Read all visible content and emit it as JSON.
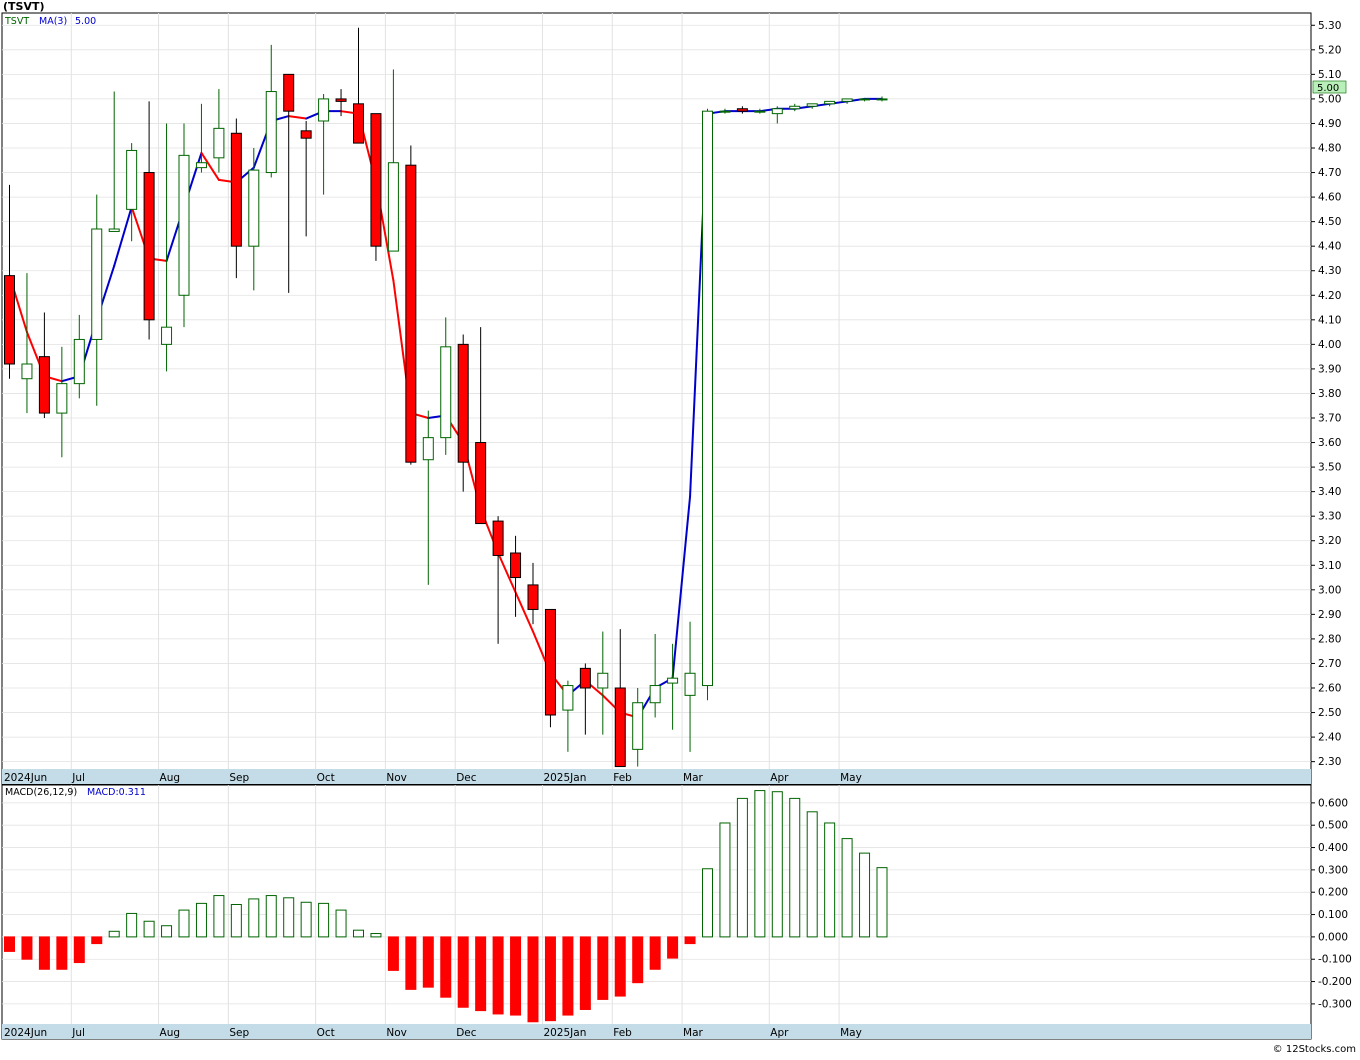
{
  "header": {
    "ticker_label": "(TSVT)"
  },
  "price_panel": {
    "legend_symbol": "TSVT",
    "legend_ma_label": "MA(3)",
    "legend_ma_value": "5.00",
    "last_price_badge": "5.00"
  },
  "macd_panel": {
    "legend_label": "MACD(26,12,9)",
    "legend_value": "MACD:0.311"
  },
  "footer": {
    "watermark": "© 12Stocks.com"
  },
  "colors": {
    "up": "#006400",
    "down": "#ff0000",
    "ma_up": "#0000cc",
    "ma_down": "#ff0000",
    "axis_band": "#c4dce8",
    "grid": "#e2e2e2",
    "badge_bg": "#b9f0b9"
  },
  "chart_data": [
    {
      "type": "candlestick",
      "period": "weekly",
      "y_axis": {
        "range": [
          2.27,
          5.35
        ],
        "ticks": [
          "2.30",
          "2.40",
          "2.50",
          "2.60",
          "2.70",
          "2.80",
          "2.90",
          "3.00",
          "3.10",
          "3.20",
          "3.30",
          "3.40",
          "3.50",
          "3.60",
          "3.70",
          "3.80",
          "3.90",
          "4.00",
          "4.10",
          "4.20",
          "4.30",
          "4.40",
          "4.50",
          "4.60",
          "4.70",
          "4.80",
          "4.90",
          "5.00",
          "5.10",
          "5.20",
          "5.30"
        ]
      },
      "x_axis": {
        "labels": [
          {
            "label": "2024Jun",
            "week": 0
          },
          {
            "label": "Jul",
            "week": 4
          },
          {
            "label": "Aug",
            "week": 9
          },
          {
            "label": "Sep",
            "week": 13
          },
          {
            "label": "Oct",
            "week": 18
          },
          {
            "label": "Nov",
            "week": 22
          },
          {
            "label": "Dec",
            "week": 26
          },
          {
            "label": "2025Jan",
            "week": 31
          },
          {
            "label": "Feb",
            "week": 35
          },
          {
            "label": "Mar",
            "week": 39
          },
          {
            "label": "Apr",
            "week": 44
          },
          {
            "label": "May",
            "week": 48
          }
        ]
      },
      "candles": [
        {
          "o": 4.28,
          "h": 4.65,
          "l": 3.86,
          "c": 3.92
        },
        {
          "o": 3.86,
          "h": 4.29,
          "l": 3.72,
          "c": 3.92
        },
        {
          "o": 3.95,
          "h": 4.13,
          "l": 3.7,
          "c": 3.72
        },
        {
          "o": 3.72,
          "h": 3.99,
          "l": 3.54,
          "c": 3.84
        },
        {
          "o": 3.84,
          "h": 4.12,
          "l": 3.78,
          "c": 4.02
        },
        {
          "o": 4.02,
          "h": 4.61,
          "l": 3.75,
          "c": 4.47
        },
        {
          "o": 4.46,
          "h": 5.03,
          "l": 4.46,
          "c": 4.47
        },
        {
          "o": 4.55,
          "h": 4.82,
          "l": 4.42,
          "c": 4.79
        },
        {
          "o": 4.7,
          "h": 4.99,
          "l": 4.02,
          "c": 4.1
        },
        {
          "o": 4.0,
          "h": 4.9,
          "l": 3.89,
          "c": 4.07
        },
        {
          "o": 4.2,
          "h": 4.9,
          "l": 4.07,
          "c": 4.77
        },
        {
          "o": 4.72,
          "h": 4.98,
          "l": 4.7,
          "c": 4.74
        },
        {
          "o": 4.76,
          "h": 5.04,
          "l": 4.7,
          "c": 4.88
        },
        {
          "o": 4.86,
          "h": 4.92,
          "l": 4.27,
          "c": 4.4
        },
        {
          "o": 4.4,
          "h": 4.8,
          "l": 4.22,
          "c": 4.71
        },
        {
          "o": 4.7,
          "h": 5.22,
          "l": 4.68,
          "c": 5.03
        },
        {
          "o": 5.1,
          "h": 5.1,
          "l": 4.21,
          "c": 4.95
        },
        {
          "o": 4.87,
          "h": 4.91,
          "l": 4.44,
          "c": 4.84
        },
        {
          "o": 4.91,
          "h": 5.02,
          "l": 4.61,
          "c": 5.0
        },
        {
          "o": 5.0,
          "h": 5.04,
          "l": 4.93,
          "c": 4.99
        },
        {
          "o": 4.98,
          "h": 5.29,
          "l": 4.87,
          "c": 4.82
        },
        {
          "o": 4.94,
          "h": 4.94,
          "l": 4.34,
          "c": 4.4
        },
        {
          "o": 4.38,
          "h": 5.12,
          "l": 4.38,
          "c": 4.74
        },
        {
          "o": 4.73,
          "h": 4.81,
          "l": 3.51,
          "c": 3.52
        },
        {
          "o": 3.53,
          "h": 3.73,
          "l": 3.02,
          "c": 3.62
        },
        {
          "o": 3.62,
          "h": 4.11,
          "l": 3.55,
          "c": 3.99
        },
        {
          "o": 4.0,
          "h": 4.04,
          "l": 3.4,
          "c": 3.52
        },
        {
          "o": 3.6,
          "h": 4.07,
          "l": 3.27,
          "c": 3.27
        },
        {
          "o": 3.28,
          "h": 3.3,
          "l": 2.78,
          "c": 3.14
        },
        {
          "o": 3.15,
          "h": 3.22,
          "l": 2.89,
          "c": 3.05
        },
        {
          "o": 3.02,
          "h": 3.11,
          "l": 2.86,
          "c": 2.92
        },
        {
          "o": 2.92,
          "h": 2.92,
          "l": 2.44,
          "c": 2.49
        },
        {
          "o": 2.51,
          "h": 2.63,
          "l": 2.34,
          "c": 2.61
        },
        {
          "o": 2.68,
          "h": 2.7,
          "l": 2.41,
          "c": 2.6
        },
        {
          "o": 2.6,
          "h": 2.83,
          "l": 2.41,
          "c": 2.66
        },
        {
          "o": 2.6,
          "h": 2.84,
          "l": 2.28,
          "c": 2.28
        },
        {
          "o": 2.35,
          "h": 2.6,
          "l": 2.28,
          "c": 2.54
        },
        {
          "o": 2.54,
          "h": 2.82,
          "l": 2.48,
          "c": 2.61
        },
        {
          "o": 2.62,
          "h": 2.78,
          "l": 2.43,
          "c": 2.64
        },
        {
          "o": 2.57,
          "h": 2.87,
          "l": 2.34,
          "c": 2.66
        },
        {
          "o": 2.61,
          "h": 4.96,
          "l": 2.55,
          "c": 4.95
        },
        {
          "o": 4.95,
          "h": 4.96,
          "l": 4.94,
          "c": 4.95
        },
        {
          "o": 4.96,
          "h": 4.97,
          "l": 4.94,
          "c": 4.95
        },
        {
          "o": 4.95,
          "h": 4.96,
          "l": 4.94,
          "c": 4.95
        },
        {
          "o": 4.94,
          "h": 4.97,
          "l": 4.9,
          "c": 4.96
        },
        {
          "o": 4.96,
          "h": 4.98,
          "l": 4.95,
          "c": 4.97
        },
        {
          "o": 4.97,
          "h": 4.98,
          "l": 4.96,
          "c": 4.98
        },
        {
          "o": 4.98,
          "h": 4.99,
          "l": 4.97,
          "c": 4.99
        },
        {
          "o": 4.99,
          "h": 5.0,
          "l": 4.98,
          "c": 5.0
        },
        {
          "o": 5.0,
          "h": 5.0,
          "l": 4.99,
          "c": 5.0
        },
        {
          "o": 5.0,
          "h": 5.01,
          "l": 4.99,
          "c": 5.0
        }
      ],
      "ma3": [
        4.28,
        4.05,
        3.87,
        3.85,
        3.87,
        4.1,
        4.32,
        4.56,
        4.35,
        4.34,
        4.56,
        4.78,
        4.67,
        4.66,
        4.72,
        4.91,
        4.93,
        4.92,
        4.95,
        4.95,
        4.94,
        4.66,
        4.26,
        3.72,
        3.7,
        3.71,
        3.6,
        3.33,
        3.15,
        2.99,
        2.83,
        2.66,
        2.57,
        2.63,
        2.57,
        2.5,
        2.48,
        2.6,
        2.64,
        3.38,
        4.94,
        4.95,
        4.95,
        4.95,
        4.96,
        4.96,
        4.97,
        4.98,
        4.99,
        5.0,
        5.0
      ]
    },
    {
      "type": "bar",
      "name": "MACD(26,12,9)",
      "y_axis": {
        "range": [
          -0.39,
          0.68
        ],
        "ticks": [
          "-0.300",
          "-0.200",
          "-0.100",
          "0.000",
          "0.100",
          "0.200",
          "0.300",
          "0.400",
          "0.500",
          "0.600"
        ]
      },
      "values": [
        -0.065,
        -0.1,
        -0.145,
        -0.145,
        -0.115,
        -0.03,
        0.025,
        0.105,
        0.07,
        0.05,
        0.12,
        0.15,
        0.185,
        0.145,
        0.17,
        0.185,
        0.175,
        0.155,
        0.15,
        0.12,
        0.03,
        0.015,
        -0.15,
        -0.235,
        -0.225,
        -0.27,
        -0.315,
        -0.33,
        -0.345,
        -0.35,
        -0.38,
        -0.375,
        -0.35,
        -0.325,
        -0.28,
        -0.265,
        -0.205,
        -0.145,
        -0.095,
        -0.03,
        0.305,
        0.51,
        0.62,
        0.655,
        0.65,
        0.62,
        0.56,
        0.51,
        0.44,
        0.375,
        0.31
      ]
    }
  ]
}
